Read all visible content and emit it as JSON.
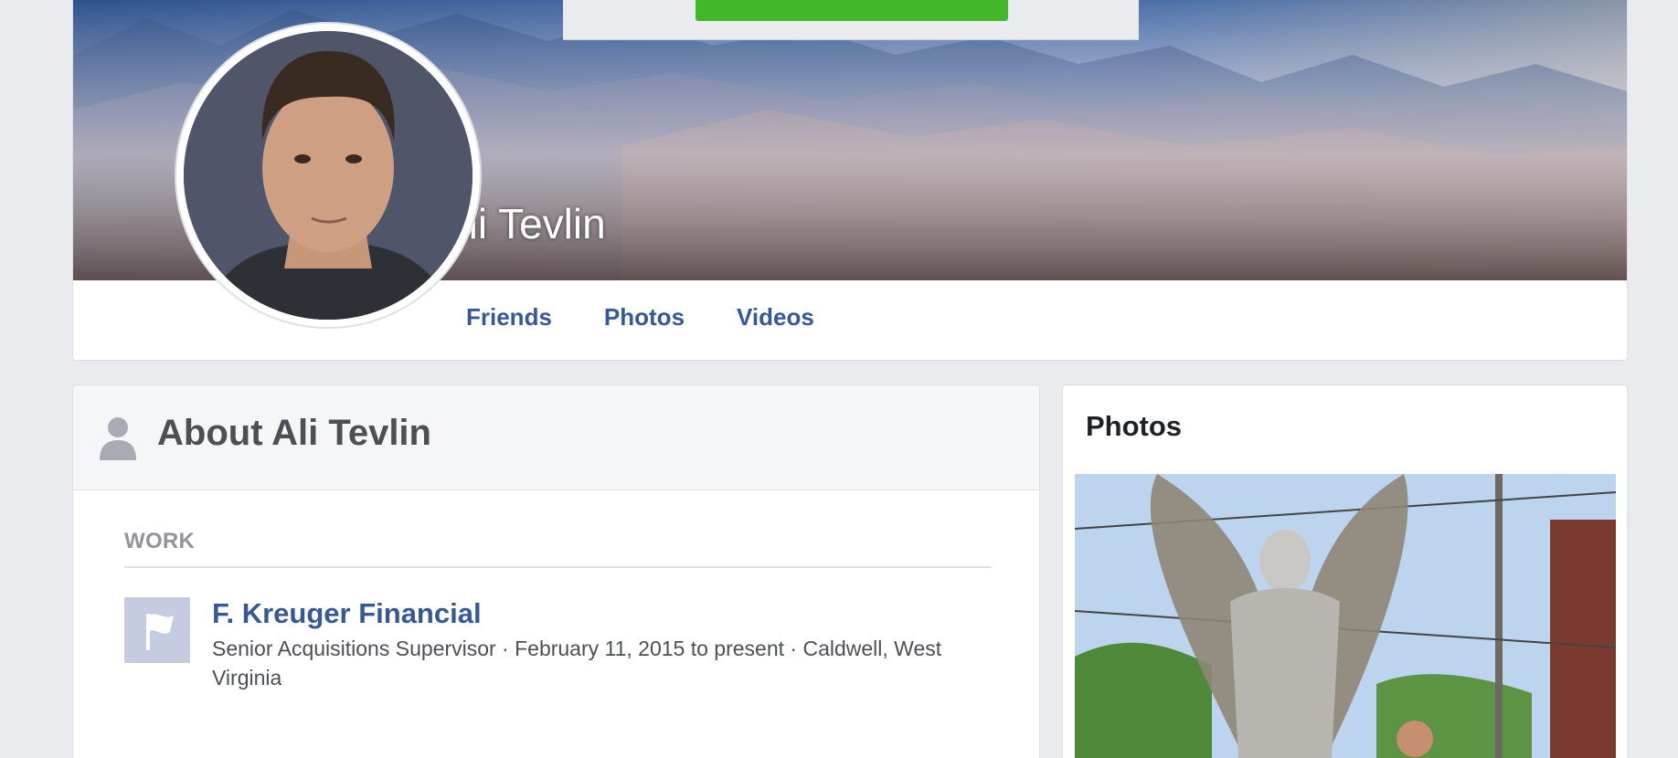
{
  "profile": {
    "name": "Ali Tevlin",
    "tabs": [
      {
        "label": "Friends"
      },
      {
        "label": "Photos"
      },
      {
        "label": "Videos"
      }
    ]
  },
  "about": {
    "title": "About Ali Tevlin",
    "work_label": "WORK",
    "work": {
      "company": "F. Kreuger Financial",
      "details": "Senior Acquisitions Supervisor · February 11, 2015 to present · Caldwell, West Virginia"
    }
  },
  "photos": {
    "title": "Photos"
  },
  "icons": {
    "person": "person-silhouette-icon",
    "work": "flag-icon"
  },
  "colors": {
    "link": "#365899",
    "signup_green": "#42b72a",
    "background": "#e9ebee"
  }
}
